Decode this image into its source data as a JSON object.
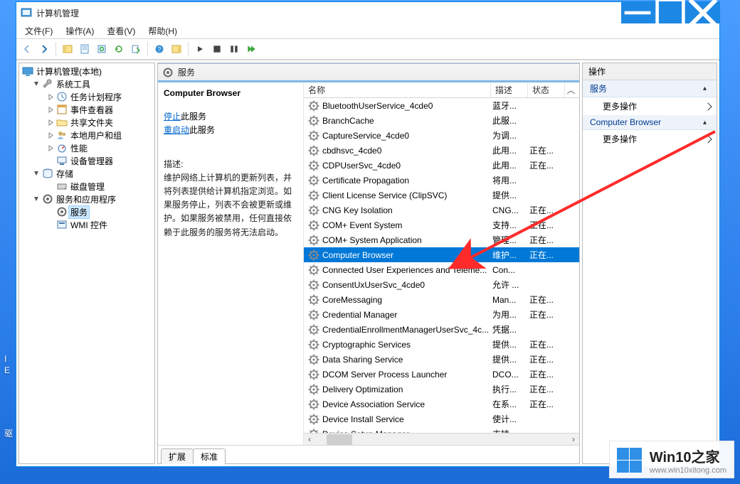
{
  "window": {
    "title": "计算机管理"
  },
  "menus": [
    "文件(F)",
    "操作(A)",
    "查看(V)",
    "帮助(H)"
  ],
  "mid_header": "服务",
  "tree": {
    "root": "计算机管理(本地)",
    "nodes": [
      {
        "label": "系统工具",
        "expanded": true,
        "children": [
          {
            "label": "任务计划程序"
          },
          {
            "label": "事件查看器"
          },
          {
            "label": "共享文件夹"
          },
          {
            "label": "本地用户和组"
          },
          {
            "label": "性能"
          },
          {
            "label": "设备管理器"
          }
        ]
      },
      {
        "label": "存储",
        "expanded": true,
        "children": [
          {
            "label": "磁盘管理"
          }
        ]
      },
      {
        "label": "服务和应用程序",
        "expanded": true,
        "children": [
          {
            "label": "服务",
            "selected": true
          },
          {
            "label": "WMI 控件"
          }
        ]
      }
    ]
  },
  "detail": {
    "title": "Computer Browser",
    "stop_link": "停止",
    "stop_suffix": "此服务",
    "restart_link": "重启动",
    "restart_suffix": "此服务",
    "desc_label": "描述:",
    "desc_body": "维护网络上计算机的更新列表，并将列表提供给计算机指定浏览。如果服务停止，列表不会被更新或维护。如果服务被禁用，任何直接依赖于此服务的服务将无法启动。"
  },
  "columns": {
    "name": "名称",
    "desc": "描述",
    "status": "状态"
  },
  "services": [
    {
      "name": "BluetoothUserService_4cde0",
      "desc": "蓝牙...",
      "status": ""
    },
    {
      "name": "BranchCache",
      "desc": "此服...",
      "status": ""
    },
    {
      "name": "CaptureService_4cde0",
      "desc": "为调...",
      "status": ""
    },
    {
      "name": "cbdhsvc_4cde0",
      "desc": "此用...",
      "status": "正在..."
    },
    {
      "name": "CDPUserSvc_4cde0",
      "desc": "此用...",
      "status": "正在..."
    },
    {
      "name": "Certificate Propagation",
      "desc": "将用...",
      "status": ""
    },
    {
      "name": "Client License Service (ClipSVC)",
      "desc": "提供...",
      "status": ""
    },
    {
      "name": "CNG Key Isolation",
      "desc": "CNG...",
      "status": "正在..."
    },
    {
      "name": "COM+ Event System",
      "desc": "支持...",
      "status": "正在..."
    },
    {
      "name": "COM+ System Application",
      "desc": "管理...",
      "status": "正在..."
    },
    {
      "name": "Computer Browser",
      "desc": "维护...",
      "status": "正在...",
      "selected": true
    },
    {
      "name": "Connected User Experiences and Teleme...",
      "desc": "Con...",
      "status": ""
    },
    {
      "name": "ConsentUxUserSvc_4cde0",
      "desc": "允许 ...",
      "status": ""
    },
    {
      "name": "CoreMessaging",
      "desc": "Man...",
      "status": "正在..."
    },
    {
      "name": "Credential Manager",
      "desc": "为用...",
      "status": "正在..."
    },
    {
      "name": "CredentialEnrollmentManagerUserSvc_4c...",
      "desc": "凭据...",
      "status": ""
    },
    {
      "name": "Cryptographic Services",
      "desc": "提供...",
      "status": "正在..."
    },
    {
      "name": "Data Sharing Service",
      "desc": "提供...",
      "status": "正在..."
    },
    {
      "name": "DCOM Server Process Launcher",
      "desc": "DCO...",
      "status": "正在..."
    },
    {
      "name": "Delivery Optimization",
      "desc": "执行...",
      "status": "正在..."
    },
    {
      "name": "Device Association Service",
      "desc": "在系...",
      "status": "正在..."
    },
    {
      "name": "Device Install Service",
      "desc": "使计...",
      "status": ""
    },
    {
      "name": "Device Setup Manager",
      "desc": "支持...",
      "status": ""
    }
  ],
  "tabs": {
    "extended": "扩展",
    "standard": "标准"
  },
  "actions": {
    "header": "操作",
    "section1": "服务",
    "more1": "更多操作",
    "section2": "Computer Browser",
    "more2": "更多操作"
  },
  "watermark": {
    "big": "Win10之家",
    "small": "www.win10xitong.com"
  },
  "desktop": {
    "line1": "I",
    "line2": "E",
    "line3": "驱"
  }
}
